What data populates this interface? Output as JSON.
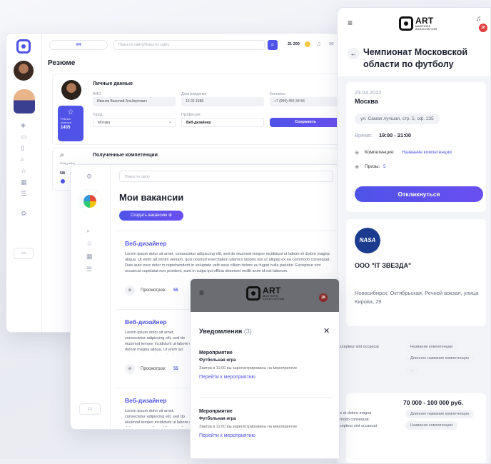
{
  "resume": {
    "header": {
      "role_pill": "VR",
      "search_placeholder": "Поиск по сайту/Поиск по сайту",
      "points": "21 200"
    },
    "title": "Резюме",
    "personal": {
      "heading": "Личные данные",
      "labels": {
        "fio": "ФИО",
        "dob": "Дата рождения",
        "contacts": "Контакты",
        "city": "Город",
        "profession": "Профессия"
      },
      "values": {
        "fio": "Иванов Василий Альбертович",
        "dob": "12.02.1988",
        "contacts": "+7 (999) 456-34-56",
        "city": "Москва",
        "profession": "Веб-дизайнер"
      },
      "save": "Сохранить"
    },
    "rating": {
      "label": "Рейтинг ученика",
      "value": "1435"
    },
    "competences_heading": "Полученные компетенции",
    "side_card": {
      "label": "Рейд работ",
      "value": "5/8"
    }
  },
  "vacancies": {
    "search_placeholder": "Поиск по сайту",
    "title": "Мои вакансии",
    "create_button": "Создать вакансию",
    "items": [
      {
        "title": "Веб-дизайнер",
        "text": "Lorem ipsum dolor sit amet, consectetur adipiscing elit, sed do eiusmod tempor incididunt ut labore et dolore magna aliqua. Ut enim ad minim veniam, quis nostrud exercitation ullamco laboris nisi ut aliquip ex ea commodo consequat. Duis aute irure dolor in reprehenderit in voluptate velit esse cillum dolore eu fugiat nulla pariatur. Excepteur sint occaecat cupidatat non proident, sunt in culpa qui officia deserunt mollit anim id est laborum.",
        "views_label": "Просмотров:",
        "views": "55"
      },
      {
        "title": "Веб-дизайнер",
        "text": "Lorem ipsum dolor sit amet, consectetur adipiscing elit, sed do eiusmod tempor incididunt ut labore et dolore magna aliqua. Ut enim ad minim veniam, quis nostrud exercitation ullamco laboris nisi ut aliquip ex ea commodo consequat. Duis aute irure dolor in reprehenderit in voluptate velit esse cillum dolore eu fugiat nulla pariatur. Excepteur sint occaecat cupidatat non proident, sunt in culpa qui officia deserunt mollit anim id est laborum.",
        "views_label": "Просмотров:",
        "views": "55"
      },
      {
        "title": "Веб-дизайнер",
        "text": "Lorem ipsum dolor sit amet, consectetur adipiscing elit, sed do eiusmod tempor incididunt ut labore et dolore magna aliqua. Ut enim ad minim veniam, quis nostrud exercitation ullamco laboris nisi ut aliquip ex ea commodo consequat. Duis aute irure dolor in reprehenderit in voluptate velit esse cillum dolore eu fugiat nulla pariatur.",
        "views_label": "",
        "views": ""
      }
    ]
  },
  "logo": {
    "main": "ART",
    "sub": "MASTERS",
    "tag": "ASSOCIATION"
  },
  "event": {
    "title": "Чемпионат Московской области по футболу",
    "date": "23.04.2022",
    "city": "Москва",
    "address": "ул. Самая лучшая, стр. 5, оф. 235",
    "time_label": "Время:",
    "time": "19:00 - 21:00",
    "competence_label": "Компетенция:",
    "competence": "Название компетенции",
    "prizes_label": "Призы:",
    "prizes": "5",
    "respond": "Откликнуться",
    "notif_count": "28"
  },
  "company": {
    "logo_text": "NASA",
    "name": "ООО \"IT ЗВЕЗДА\"",
    "address": "Новосибирск, Октябрьская, Речной вокзал, улица Кирова, 29",
    "excerpt": "xcepteur sint occaecat",
    "chips": [
      "Название компетенции",
      "Длинное название компетенции",
      "..."
    ]
  },
  "salary_card": {
    "salary": "70 000 - 100 000 руб.",
    "excerpt1": "e et dolore magna",
    "excerpt2": "modo consequat.",
    "excerpt3": "cepteur sint occaecat",
    "chips": [
      "Длинное название компетенции",
      "Название компетенции"
    ]
  },
  "notifications": {
    "title": "Уведомления",
    "count": "(3)",
    "badge": "28",
    "items": [
      {
        "type": "Мероприятие",
        "name": "Футбольная игра",
        "desc": "Завтра в 11:00 вы зарегистрированы на мероприятие",
        "link": "Перейти к мероприятию"
      },
      {
        "type": "Мероприятие",
        "name": "Футбольная игра",
        "desc": "Завтра в 11:00 вы зарегистрированы на мероприятие",
        "link": "Перейти к мероприятию"
      }
    ]
  }
}
